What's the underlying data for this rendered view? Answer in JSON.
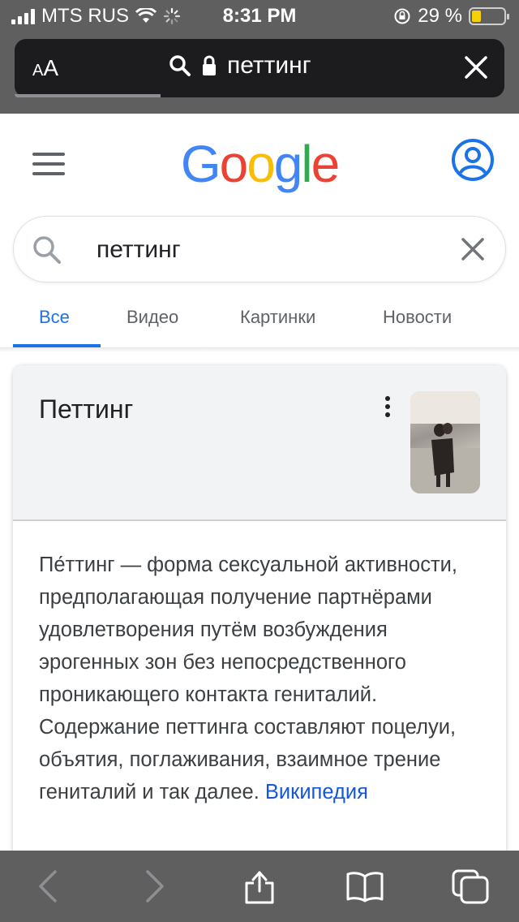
{
  "status_bar": {
    "carrier": "MTS RUS",
    "time": "8:31 PM",
    "battery_percent": "29 %",
    "battery_level": 0.29
  },
  "address_bar": {
    "text_size_label": "AA",
    "url_text": "петтинг"
  },
  "google": {
    "logo_letters": [
      "G",
      "o",
      "o",
      "g",
      "l",
      "e"
    ],
    "logo_colors": [
      "#4285F4",
      "#EA4335",
      "#FBBC05",
      "#4285F4",
      "#34A853",
      "#EA4335"
    ]
  },
  "search": {
    "query": "петтинг"
  },
  "tabs": [
    {
      "label": "Все",
      "active": true
    },
    {
      "label": "Видео",
      "active": false
    },
    {
      "label": "Картинки",
      "active": false
    },
    {
      "label": "Новости",
      "active": false
    }
  ],
  "knowledge_card": {
    "title": "Петтинг",
    "description": "Пе́ттинг — форма сексуальной активности, предполагающая получение партнёрами удовлетворения путём возбуждения эрогенных зон без непосредственного проникающего контакта гениталий. Содержание петтинга составляют поцелуи, объятия, поглаживания, взаимное трение гениталий и так далее.",
    "source_link": "Википедия"
  },
  "colors": {
    "accent": "#1a73e8",
    "chrome": "#5f5f5f",
    "link": "#1558d6"
  }
}
